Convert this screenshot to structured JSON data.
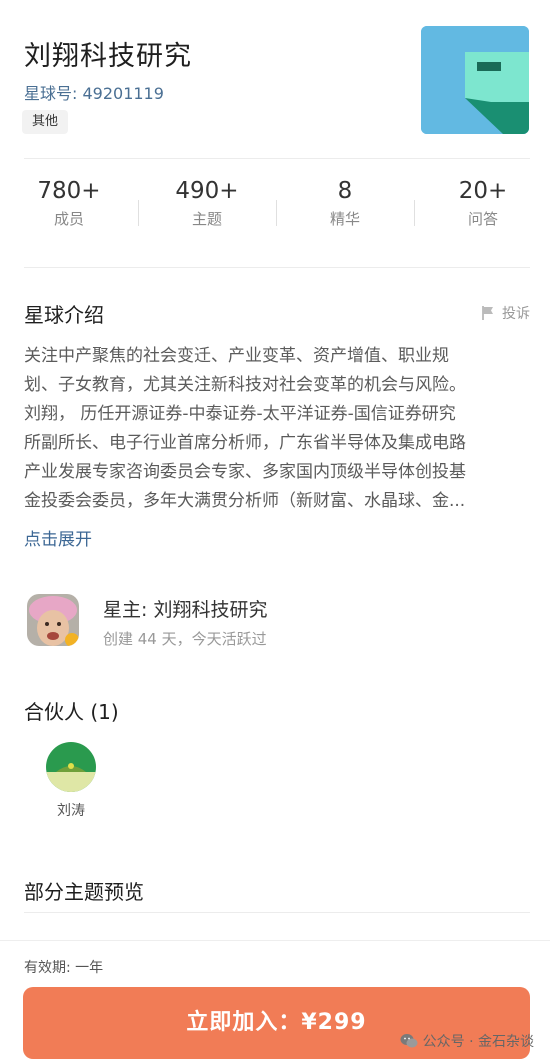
{
  "planet": {
    "title": "刘翔科技研究",
    "id_label": "星球号: 49201119",
    "tag": "其他"
  },
  "stats": [
    {
      "value": "780+",
      "label": "成员"
    },
    {
      "value": "490+",
      "label": "主题"
    },
    {
      "value": "8",
      "label": "精华"
    },
    {
      "value": "20+",
      "label": "问答"
    }
  ],
  "intro": {
    "title": "星球介绍",
    "report_label": "投诉",
    "lines": [
      "关注中产聚焦的社会变迁、产业变革、资产增值、职业规",
      "划、子女教育，尤其关注新科技对社会变革的机会与风险。",
      "刘翔， 历任开源证券-中泰证券-太平洋证券-国信证券研究",
      "所副所长、电子行业首席分析师，广东省半导体及集成电路",
      "产业发展专家咨询委员会专家、多家国内顶级半导体创投基",
      "金投委会委员，多年大满贯分析师（新财富、水晶球、金..."
    ],
    "expand_label": "点击展开"
  },
  "owner": {
    "name": "星主: 刘翔科技研究",
    "sub": "创建 44 天，今天活跃过"
  },
  "partners": {
    "title": "合伙人 (1)",
    "items": [
      {
        "name": "刘涛"
      }
    ]
  },
  "preview": {
    "title": "部分主题预览"
  },
  "bottom": {
    "validity": "有效期: 一年",
    "join_label": "立即加入：¥299",
    "watermark": "公众号 · 金石杂谈"
  },
  "colors": {
    "accent": "#f17c56",
    "link": "#3c6794",
    "cover_bg": "#62b9e2"
  }
}
